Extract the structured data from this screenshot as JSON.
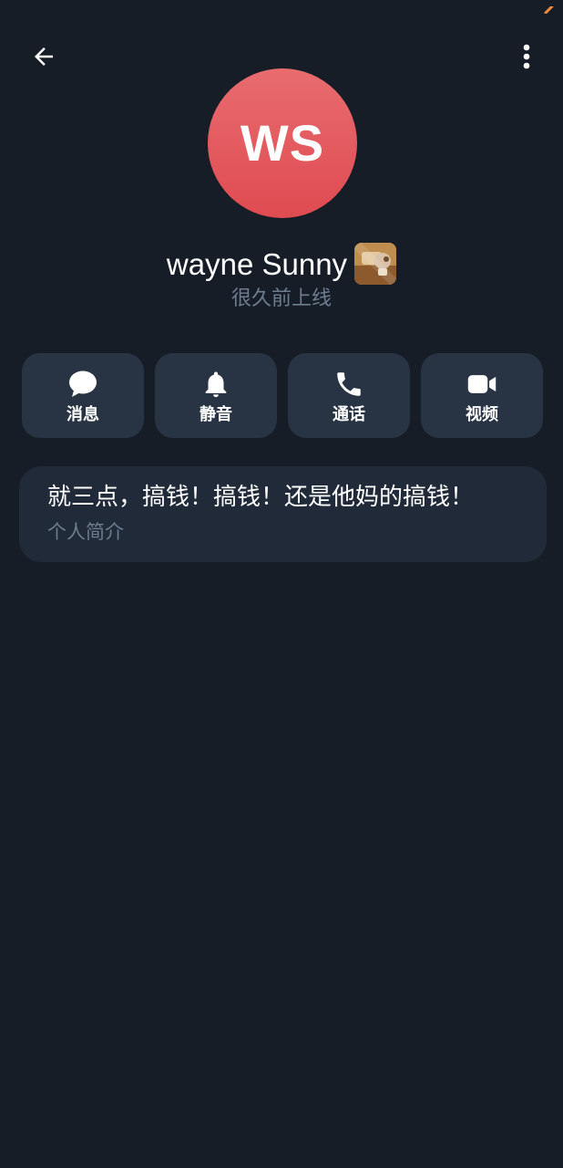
{
  "header": {
    "back_icon": "arrow-left-icon",
    "more_icon": "more-vert-icon"
  },
  "profile": {
    "initials": "WS",
    "name": "wayne Sunny",
    "status": "很久前上线",
    "avatar_color": "#e35b5e",
    "badge_icon": "sticker-badge-icon"
  },
  "actions": [
    {
      "icon": "message-icon",
      "label": "消息"
    },
    {
      "icon": "bell-icon",
      "label": "静音"
    },
    {
      "icon": "phone-icon",
      "label": "通话"
    },
    {
      "icon": "video-icon",
      "label": "视频"
    }
  ],
  "bio": {
    "text": "就三点，搞钱！搞钱！还是他妈的搞钱！",
    "label": "个人简介"
  },
  "colors": {
    "background": "#171d27",
    "action_button": "#283444",
    "bio_card": "#202a38",
    "muted_text": "#6d7d8f"
  }
}
